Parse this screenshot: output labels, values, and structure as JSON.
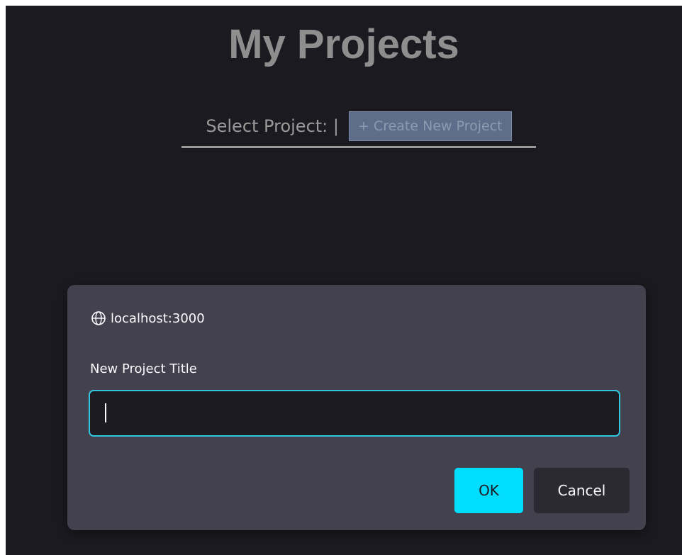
{
  "page": {
    "title": "My Projects",
    "select_label": "Select Project: |",
    "create_button_label": "+ Create New Project"
  },
  "dialog": {
    "origin": "localhost:3000",
    "origin_icon": "globe-icon",
    "prompt_label": "New Project Title",
    "input_value": "",
    "ok_label": "OK",
    "cancel_label": "Cancel"
  },
  "colors": {
    "page_background": "#1a1a20",
    "dialog_background": "#42414d",
    "input_focus_border": "#33c4de",
    "ok_button": "#00ddff",
    "cancel_button": "#2b2a33",
    "create_button": "#5e6e8a"
  }
}
